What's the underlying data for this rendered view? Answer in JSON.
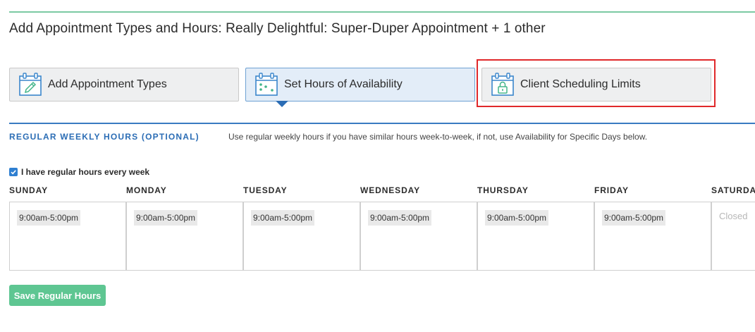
{
  "page_title": "Add Appointment Types and Hours: Really Delightful: Super-Duper Appointment + 1 other",
  "steps": [
    {
      "label": "Add Appointment Types",
      "icon": "calendar-pencil-icon",
      "active": false
    },
    {
      "label": "Set Hours of Availability",
      "icon": "calendar-dots-icon",
      "active": true
    },
    {
      "label": "Client Scheduling Limits",
      "icon": "calendar-lock-icon",
      "active": false
    }
  ],
  "section": {
    "heading": "REGULAR WEEKLY HOURS (OPTIONAL)",
    "help_text": "Use regular weekly hours if you have similar hours week-to-week, if not, use Availability for Specific Days below."
  },
  "regular_hours": {
    "checked": true,
    "label": "I have regular hours every week"
  },
  "week": [
    {
      "day": "SUNDAY",
      "hours": "9:00am-5:00pm"
    },
    {
      "day": "MONDAY",
      "hours": "9:00am-5:00pm"
    },
    {
      "day": "TUESDAY",
      "hours": "9:00am-5:00pm"
    },
    {
      "day": "WEDNESDAY",
      "hours": "9:00am-5:00pm"
    },
    {
      "day": "THURSDAY",
      "hours": "9:00am-5:00pm"
    },
    {
      "day": "FRIDAY",
      "hours": "9:00am-5:00pm"
    },
    {
      "day": "SATURDAY",
      "closed": "Closed"
    }
  ],
  "save_button": "Save Regular Hours",
  "colors": {
    "accent_blue": "#2b6db5",
    "accent_green": "#5ec692",
    "highlight_red": "#e0282a",
    "icon_blue": "#3a86cc",
    "icon_green": "#43b58a"
  }
}
